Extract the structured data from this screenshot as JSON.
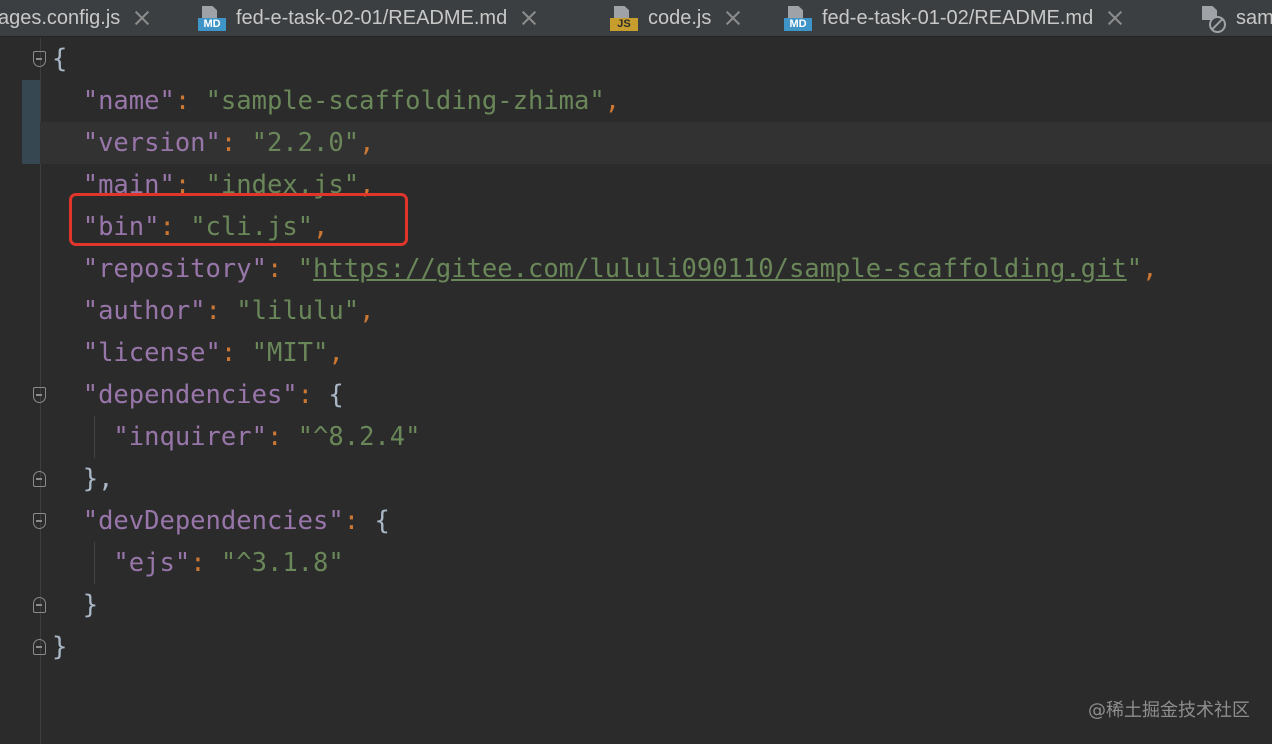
{
  "tabs": [
    {
      "label": "ages.config.js",
      "icon": "none",
      "badge": ""
    },
    {
      "label": "fed-e-task-02-01/README.md",
      "icon": "markdown-file-icon",
      "badge": "MD"
    },
    {
      "label": "code.js",
      "icon": "javascript-file-icon",
      "badge": "JS"
    },
    {
      "label": "fed-e-task-01-02/README.md",
      "icon": "markdown-file-icon",
      "badge": "MD"
    },
    {
      "label": "sam",
      "icon": "excluded-file-icon",
      "badge": ""
    }
  ],
  "code": {
    "l1_open": "{",
    "name_key": "\"name\"",
    "name_value": "\"sample-scaffolding-zhima\"",
    "version_key": "\"version\"",
    "version_value": "\"2.2.0\"",
    "main_key": "\"main\"",
    "main_value": "\"index.js\"",
    "bin_key": "\"bin\"",
    "bin_value": "\"cli.js\"",
    "repository_key": "\"repository\"",
    "repository_value": "https://gitee.com/lululi090110/sample-scaffolding.git",
    "author_key": "\"author\"",
    "author_value": "\"lilulu\"",
    "license_key": "\"license\"",
    "license_value": "\"MIT\"",
    "dependencies_key": "\"dependencies\"",
    "inquirer_key": "\"inquirer\"",
    "inquirer_value": "\"^8.2.4\"",
    "deps_close": "},",
    "devdependencies_key": "\"devDependencies\"",
    "ejs_key": "\"ejs\"",
    "ejs_value": "\"^3.1.8\"",
    "devdeps_close": "}",
    "root_close": "}",
    "colon": ": ",
    "comma": ",",
    "open_brace": "{",
    "quote": "\""
  },
  "watermark": "@稀土掘金技术社区",
  "colors": {
    "background": "#2b2b2b",
    "json_key": "#9876aa",
    "json_string": "#6a8759",
    "punctuation": "#cc7832",
    "highlight_box": "#e0352b"
  }
}
